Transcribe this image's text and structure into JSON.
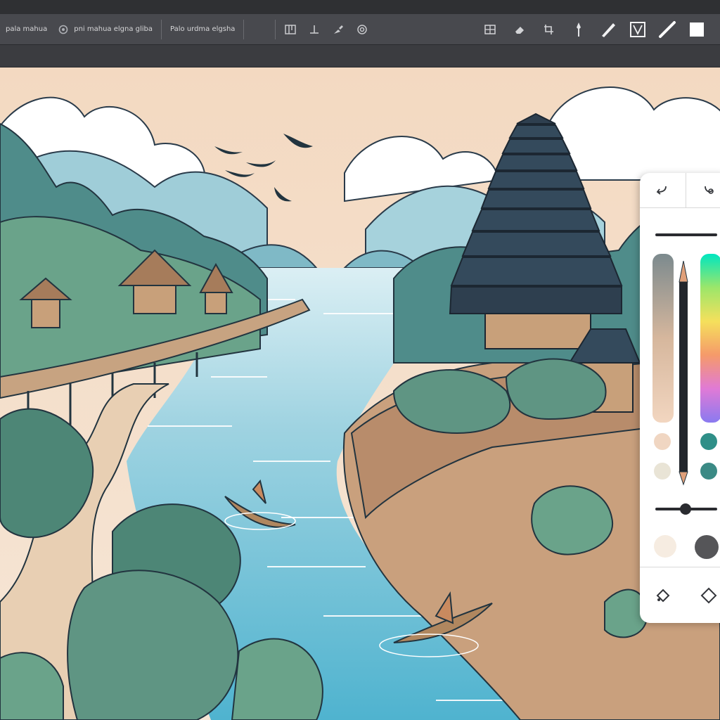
{
  "window": {
    "tabs": [
      {
        "label": "pala mahua"
      },
      {
        "label": "pni mahua elgna gliba"
      },
      {
        "label": "Palo urdma elgsha"
      }
    ]
  },
  "toolbar": {
    "left_tools": [
      "layout-icon",
      "baseline-icon",
      "brush-dropper-icon",
      "circle-target-icon"
    ],
    "right_tools": [
      "grid-icon",
      "eraser-icon",
      "crop-icon",
      "pen-nib-icon",
      "brush-icon",
      "frame-icon",
      "line-icon",
      "square-icon"
    ]
  },
  "palette": {
    "top_buttons": [
      "undo-icon",
      "redo-icon"
    ],
    "size_value": 0.6,
    "opacity_value": 0.4,
    "colors": {
      "accent": "#2f8f88",
      "teal": "#3b8a85",
      "peach": "#f0d6c2",
      "sand": "#e9e4d6",
      "dark": "#2a2b30",
      "grey": "#555558",
      "cream": "#f6ece1",
      "toolbar_bg": "#48494e"
    },
    "bottom_buttons": [
      "lasso-icon",
      "transform-icon"
    ]
  }
}
